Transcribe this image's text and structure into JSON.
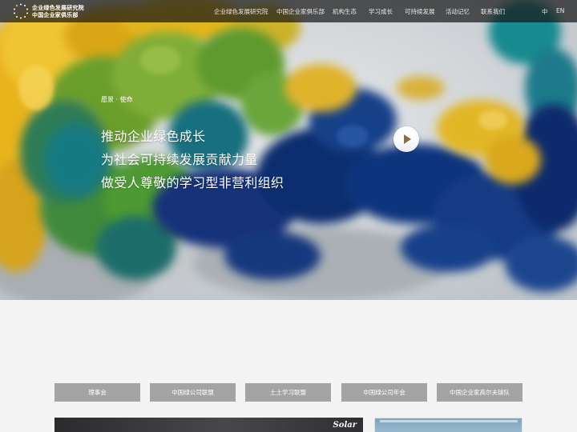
{
  "header": {
    "logo_line1": "企业绿色发展研究院",
    "logo_line2": "中国企业家俱乐部",
    "nav": [
      "企业绿色发展研究院",
      "中国企业家俱乐部",
      "机构生态",
      "学习成长",
      "可持续发展",
      "活动记忆",
      "联系我们"
    ],
    "lang_zh": "中",
    "lang_en": "EN"
  },
  "hero": {
    "kicker": "愿景 · 使命",
    "lines": [
      "推动企业绿色成长",
      "为社会可持续发展贡献力量",
      "做受人尊敬的学习型非营利组织"
    ]
  },
  "tabs": [
    "理事会",
    "中国绿公司联盟",
    "土土学习联盟",
    "中国绿公司年会",
    "中国企业家高尔夫球队"
  ],
  "cards": {
    "left_caption": "Solar"
  },
  "colors": {
    "nav_bg": "#191919",
    "tab_bg": "#a4a4a4",
    "page_bg": "#f4f4f4",
    "ink_yellow": "#e3b51f",
    "ink_green": "#5f9a2e",
    "ink_blue": "#11357e",
    "ink_teal": "#127a82"
  },
  "icons": {
    "logo": "dotted-circle-logo-icon",
    "play": "play-icon"
  }
}
